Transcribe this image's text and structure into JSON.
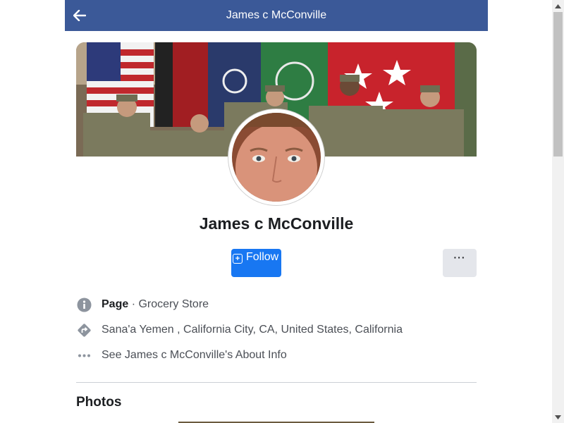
{
  "header": {
    "title": "James c McConville"
  },
  "profile": {
    "name": "James c McConville",
    "follow_label": "Follow",
    "more_label": "···"
  },
  "info": {
    "page_label": "Page",
    "separator": " · ",
    "category": "Grocery Store",
    "location": "Sana'a Yemen , California City, CA, United States, California",
    "about": "See James c McConville's About Info"
  },
  "sections": {
    "photos_title": "Photos"
  },
  "icons": {
    "back": "arrow-left-icon",
    "info": "info-icon",
    "directions": "directions-icon",
    "more": "more-dots-icon"
  },
  "colors": {
    "header_bg": "#3b5998",
    "follow_bg": "#1877f2",
    "more_bg": "#e4e6eb"
  }
}
